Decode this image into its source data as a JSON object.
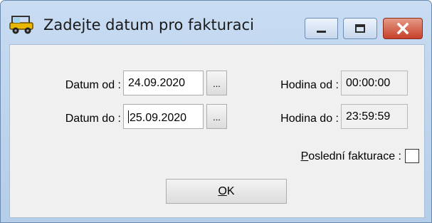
{
  "window": {
    "title": "Zadejte datum pro fakturaci",
    "icon": "jeep-car-icon",
    "controls": {
      "minimize": "minimize-icon",
      "maximize": "maximize-icon",
      "close": "close-icon"
    }
  },
  "form": {
    "datum_od": {
      "label": "Datum od :",
      "value": "24.09.2020",
      "picker_label": "..."
    },
    "datum_do": {
      "label": "Datum do :",
      "value": "25.09.2020",
      "picker_label": "..."
    },
    "hodina_od": {
      "label": "Hodina od :",
      "value": "00:00:00"
    },
    "hodina_do": {
      "label": "Hodina do :",
      "value": "23:59:59"
    },
    "posledni_fakturace": {
      "label_first": "P",
      "label_rest": "oslední fakturace :",
      "checked": false
    }
  },
  "ok_button": {
    "label_first": "O",
    "label_rest": "K"
  },
  "colors": {
    "close_button": "#c7412a",
    "title_bar": "#c8dcf2",
    "client_background": "#f0f0f0"
  }
}
